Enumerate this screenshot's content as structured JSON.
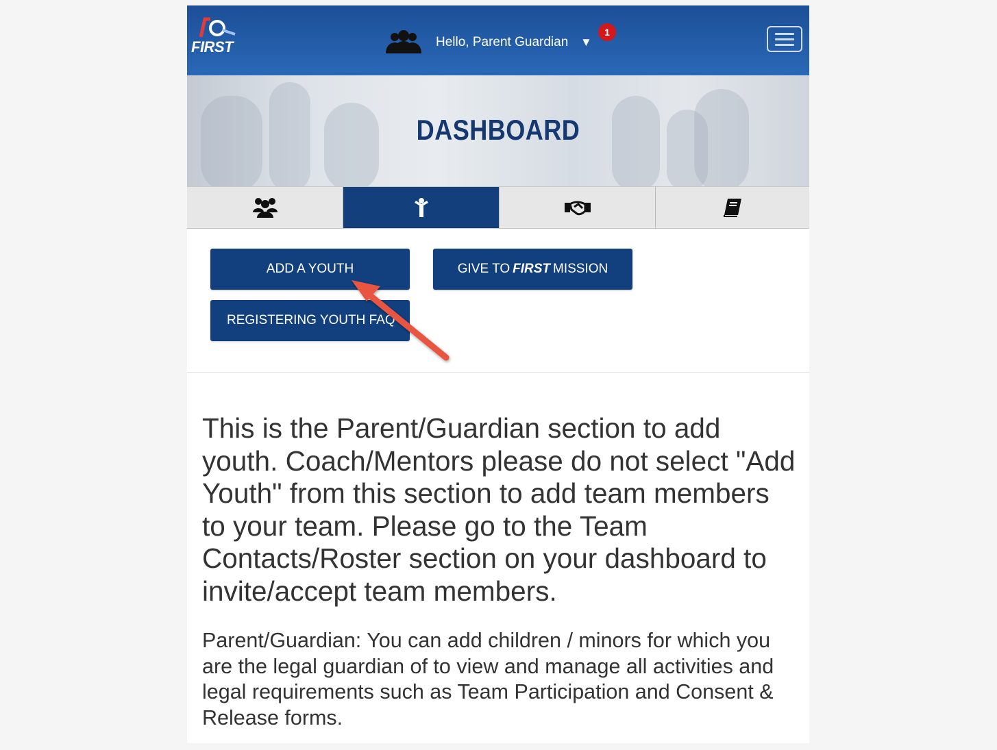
{
  "header": {
    "logo_text": "FIRST",
    "greeting": "Hello, Parent Guardian",
    "dropdown_caret": "▼",
    "notification_count": "1",
    "menu_icon": "hamburger-menu-icon"
  },
  "banner": {
    "title": "DASHBOARD"
  },
  "tabs": [
    {
      "icon": "team-icon",
      "active": false
    },
    {
      "icon": "youth-icon",
      "active": true
    },
    {
      "icon": "handshake-icon",
      "active": false
    },
    {
      "icon": "book-icon",
      "active": false
    }
  ],
  "buttons": {
    "add_youth": "ADD A YOUTH",
    "give_prefix": "GIVE TO",
    "give_brand": "FIRST",
    "give_suffix": "MISSION",
    "registering_faq": "REGISTERING YOUTH FAQ"
  },
  "content": {
    "lead": "This is the Parent/Guardian section to add youth. Coach/Mentors please do not select \"Add Youth\" from this section to add team members to your team. Please go to the Team Contacts/Roster section on your dashboard to invite/accept team members.",
    "description": "Parent/Guardian: You can add children / minors for which you are the legal guardian of to view and manage all activities and legal requirements such as Team Participation and Consent & Release forms."
  },
  "colors": {
    "header_blue": "#1c4f97",
    "navy": "#123f7e",
    "badge_red": "#d2171d",
    "annotation_arrow": "#e8553f"
  }
}
